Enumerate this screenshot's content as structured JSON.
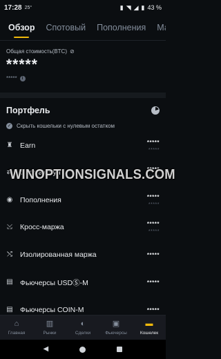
{
  "status": {
    "time": "17:28",
    "temp": "25°",
    "battery": "43 %"
  },
  "tabs": [
    {
      "label": "Обзор",
      "active": true
    },
    {
      "label": "Спотовый",
      "active": false
    },
    {
      "label": "Пополнения",
      "active": false
    },
    {
      "label": "Маржа",
      "active": false
    }
  ],
  "balance": {
    "label": "Общая стоимость(BTC)",
    "value": "*****",
    "sub": "*****"
  },
  "portfolio": {
    "title": "Портфель",
    "hide_zero": "Скрыть кошельки с нулевым остатком",
    "items": [
      {
        "name": "Earn",
        "v1": "*****",
        "v2": "*****",
        "icon": "earn-icon"
      },
      {
        "name": "Спот аккаунт",
        "v1": "*****",
        "v2": "*****",
        "icon": "spot-icon"
      },
      {
        "name": "Пополнения",
        "v1": "*****",
        "v2": "*****",
        "icon": "funding-icon"
      },
      {
        "name": "Кросс-маржа",
        "v1": "*****",
        "v2": "*****",
        "icon": "cross-margin-icon"
      },
      {
        "name": "Изолированная маржа",
        "v1": "*****",
        "v2": "",
        "icon": "isolated-margin-icon"
      },
      {
        "name": "Фьючерсы USDⓈ-M",
        "v1": "*****",
        "v2": "",
        "icon": "futures-usdm-icon"
      },
      {
        "name": "Фьючерсы COIN-M",
        "v1": "*****",
        "v2": "",
        "icon": "futures-coinm-icon"
      }
    ]
  },
  "watermark": "WINOPTIONSIGNALS.COM",
  "bottom_nav": [
    {
      "label": "Главная",
      "icon": "home-icon",
      "active": false
    },
    {
      "label": "Рынки",
      "icon": "markets-icon",
      "active": false
    },
    {
      "label": "Сделки",
      "icon": "trades-icon",
      "active": false
    },
    {
      "label": "Фьючерсы",
      "icon": "futures-icon",
      "active": false
    },
    {
      "label": "Кошелек",
      "icon": "wallet-icon",
      "active": true
    }
  ],
  "colors": {
    "accent": "#f0b90b",
    "background": "#0b0e11",
    "text": "#eaecef",
    "muted": "#848e9c"
  }
}
